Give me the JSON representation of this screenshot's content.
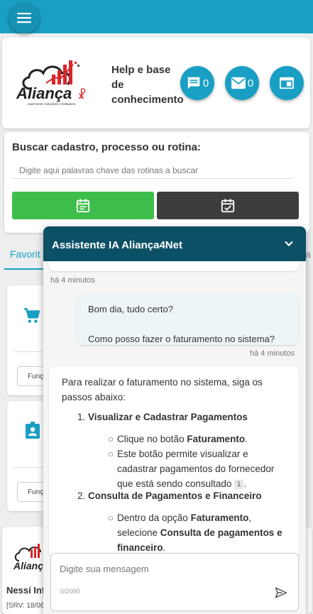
{
  "header": {
    "help_text": "Help e base de conhecimento",
    "chat_count": "0",
    "mail_count": "0",
    "logo_name": "Aliança",
    "logo_tagline": "Javé-Nessí Soluções e Softwares"
  },
  "search": {
    "title": "Buscar cadastro, processo ou rotina:",
    "placeholder": "Digite aqui palavras chave das rotinas a buscar"
  },
  "tabs": {
    "first": "Favorit",
    "right": "a"
  },
  "panels": {
    "func_label": "Funç"
  },
  "bottom": {
    "title": "Nessí Inf",
    "srv": "[SRV: 18/06"
  },
  "chat": {
    "title": "Assistente IA Aliança4Net",
    "stub_time": "há 4 minutos",
    "user_line1": "Bom dia, tudo certo?",
    "user_line2": "Como posso fazer o faturamento no sistema?",
    "user_time": "há 4 minutos",
    "bot": {
      "intro": "Para realizar o faturamento no sistema, siga os passos abaixo:",
      "step1_num": "1.",
      "step1": "Visualizar e Cadastrar Pagamentos",
      "b1_pre": "Clique no botão ",
      "b1_bold": "Faturamento",
      "b1_post": ".",
      "b2": "Este botão permite visualizar e cadastrar pagamentos do fornecedor que está sendo consultado",
      "b2_cite": "1",
      "b2_post": ".",
      "step2_num": "2.",
      "step2": "Consulta de Pagamentos e Financeiro",
      "b3_pre": "Dentro da opção ",
      "b3_bold1": "Faturamento",
      "b3_mid": ", selecione ",
      "b3_bold2": "Consulta de pagamentos e financeiro",
      "b3_post": "."
    },
    "input_placeholder": "Digite sua mensagem",
    "counter": "0/2000"
  },
  "colors": {
    "primary": "#1a9fc4",
    "chat_header": "#0c5066",
    "green_button": "#3dbe4a",
    "dark_button": "#3d3d3d"
  }
}
